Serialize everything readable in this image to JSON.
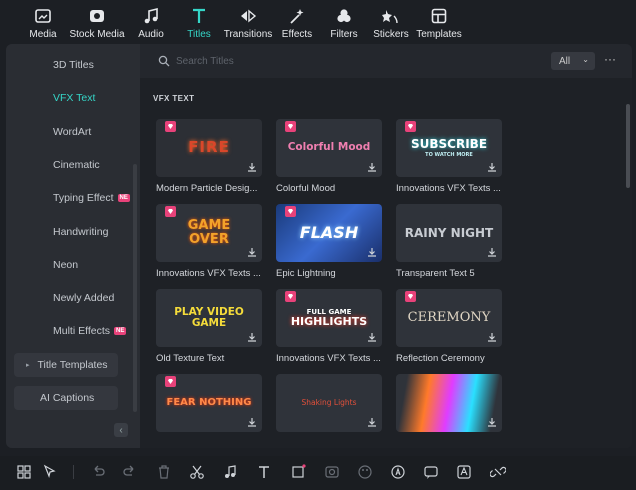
{
  "toolbar": {
    "tabs": [
      {
        "label": "Media",
        "icon": "media-icon",
        "active": false
      },
      {
        "label": "Stock Media",
        "icon": "stock-media-icon",
        "active": false
      },
      {
        "label": "Audio",
        "icon": "audio-icon",
        "active": false
      },
      {
        "label": "Titles",
        "icon": "titles-icon",
        "active": true
      },
      {
        "label": "Transitions",
        "icon": "transitions-icon",
        "active": false
      },
      {
        "label": "Effects",
        "icon": "effects-icon",
        "active": false
      },
      {
        "label": "Filters",
        "icon": "filters-icon",
        "active": false
      },
      {
        "label": "Stickers",
        "icon": "stickers-icon",
        "active": false
      },
      {
        "label": "Templates",
        "icon": "templates-icon",
        "active": false
      }
    ]
  },
  "sidebar": {
    "items": [
      {
        "label": "3D Titles"
      },
      {
        "label": "VFX Text",
        "active": true
      },
      {
        "label": "WordArt"
      },
      {
        "label": "Cinematic"
      },
      {
        "label": "Typing Effect",
        "badge": "NE"
      },
      {
        "label": "Handwriting"
      },
      {
        "label": "Neon"
      },
      {
        "label": "Newly Added"
      },
      {
        "label": "Multi Effects",
        "badge": "NE"
      }
    ],
    "title_templates": "Title Templates",
    "ai_captions": "AI Captions"
  },
  "search": {
    "placeholder": "Search Titles",
    "filter": "All"
  },
  "section": "VFX TEXT",
  "cards": [
    {
      "label": "Modern Particle Desig...",
      "thumb": "FIRE",
      "premium": true
    },
    {
      "label": "Colorful Mood",
      "thumb": "Colorful Mood",
      "premium": true
    },
    {
      "label": "Innovations VFX Texts ...",
      "thumb": "SUBSCRIBE",
      "thumb_sub": "TO WATCH MORE",
      "premium": true
    },
    {
      "label": "Innovations VFX Texts ...",
      "thumb": "GAME",
      "thumb_sub": "OVER",
      "premium": true
    },
    {
      "label": "Epic Lightning",
      "thumb": "FLASH",
      "premium": true
    },
    {
      "label": "Transparent Text 5",
      "thumb": "RAINY NIGHT",
      "premium": false
    },
    {
      "label": "Old Texture Text",
      "thumb": "PLAY VIDEO GAME",
      "premium": false
    },
    {
      "label": "Innovations VFX Texts ...",
      "thumb": "FULL GAME",
      "thumb_sub": "HIGHLIGHTS",
      "premium": true
    },
    {
      "label": "Reflection Ceremony",
      "thumb": "CEREMONY",
      "premium": true
    },
    {
      "label": "",
      "thumb": "FEAR NOTHING",
      "premium": true
    },
    {
      "label": "",
      "thumb": "Shaking Lights",
      "premium": false
    },
    {
      "label": "",
      "thumb": "",
      "premium": false
    }
  ],
  "colors": {
    "accent": "#35d6c8",
    "premium": "#e8427a",
    "panel": "#24272d"
  },
  "bottom_tools": [
    "layout-icon",
    "select-tool-icon",
    "undo-icon",
    "redo-icon",
    "delete-icon",
    "cut-icon",
    "audio-edit-icon",
    "text-icon",
    "crop-icon",
    "mask-icon",
    "color-icon",
    "ai-tool-icon",
    "speech-icon",
    "translate-icon",
    "unlink-icon"
  ]
}
